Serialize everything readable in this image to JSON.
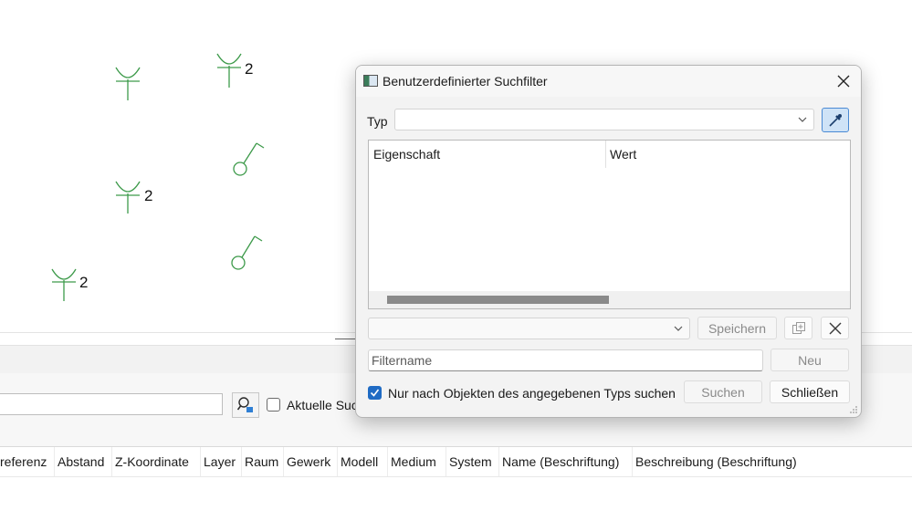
{
  "drawing": {
    "labels": [
      "2",
      "2",
      "2"
    ]
  },
  "panel": {
    "search_value": "",
    "current_checkbox_label": "Aktuelle Suc",
    "current_checkbox_checked": false
  },
  "results": {
    "columns": [
      "referenz",
      "Abstand",
      "Z-Koordinate",
      "Layer",
      "Raum",
      "Gewerk",
      "Modell",
      "Medium",
      "System",
      "Name (Beschriftung)",
      "Beschreibung (Beschriftung)"
    ]
  },
  "dialog": {
    "title": "Benutzerdefinierter Suchfilter",
    "typ_label": "Typ",
    "typ_value": "",
    "table": {
      "col_property": "Eigenschaft",
      "col_value": "Wert",
      "rows": []
    },
    "filter_select_value": "",
    "save_label": "Speichern",
    "filtername_placeholder": "Filtername",
    "new_label": "Neu",
    "only_type_label": "Nur nach Objekten des angegebenen Typs suchen",
    "only_type_checked": true,
    "search_label": "Suchen",
    "close_label": "Schließen"
  },
  "colors": {
    "symbol_green": "#3d9a4a",
    "accent_blue": "#1f6bc4",
    "picker_bg": "#cfe3f7"
  },
  "icons": [
    "pipette-icon",
    "close-icon",
    "chevron-down-icon",
    "copy-icon",
    "delete-icon",
    "search-icon",
    "checkmark-icon",
    "resize-grip-icon"
  ]
}
